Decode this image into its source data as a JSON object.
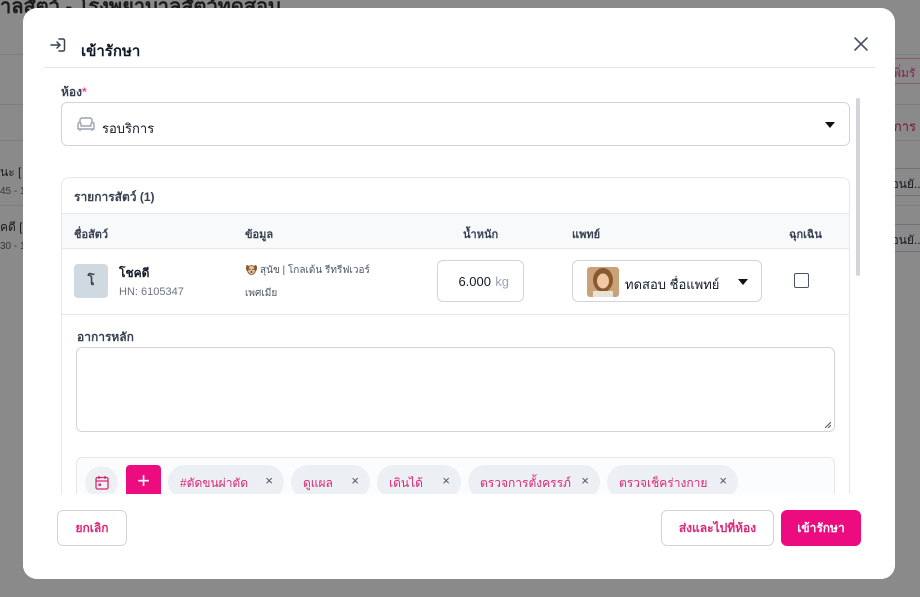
{
  "background": {
    "page_title": "าลสัตว์ - โรงพยาบาลสัตว์ทดสอบ",
    "add_button_fragment": "เพิ่มรั",
    "tab_fragment": "การ",
    "rows": [
      {
        "name_fragment": "นะ [",
        "sub_fragment": "45 - 1",
        "action_fragment": "รอนยั..."
      },
      {
        "name_fragment": "คดี [",
        "sub_fragment": "30 - 1",
        "action_fragment": "รอนยั..."
      }
    ]
  },
  "modal": {
    "title": "เข้ารักษา",
    "icons": {
      "title": "enter-icon",
      "close": "close-icon"
    },
    "room": {
      "label": "ห้อง",
      "required_mark": "*",
      "value": "รอบริการ",
      "icon": "sofa-icon"
    },
    "pets_card": {
      "title": "รายการสัตว์ (1)",
      "columns": {
        "name": "ชื่อสัตว์",
        "info": "ข้อมูล",
        "weight": "น้ำหนัก",
        "doctor": "แพทย์",
        "emergency": "ฉุกเฉิน"
      },
      "row": {
        "avatar_initial": "โ",
        "name": "โชคดี",
        "hn": "HN: 6105347",
        "species": "สุนัข | โกลเด้น รีทรีฟเวอร์",
        "sex": "เพศเมีย",
        "weight_value": "6.000",
        "weight_unit": "kg",
        "doctor_name": "ทดสอบ ชื่อแพทย์",
        "emergency_checked": false
      },
      "symptom": {
        "label": "อาการหลัก",
        "value": ""
      },
      "tags": [
        "#ตัดขนผ่าตัด",
        "ดูแผล",
        "เดินได้",
        "ตรวจการตั้งครรภ์",
        "ตรวจเช็คร่างกาย"
      ],
      "tag_remove_symbol": "×",
      "add_symbol": "+"
    },
    "footer": {
      "cancel": "ยกเลิก",
      "send_to_room": "ส่งและไปที่ห้อง",
      "admit": "เข้ารักษา"
    }
  },
  "colors": {
    "accent": "#ec0c7f",
    "accent_text": "#db2777",
    "overlay": "rgba(0,0,0,0.46)"
  }
}
